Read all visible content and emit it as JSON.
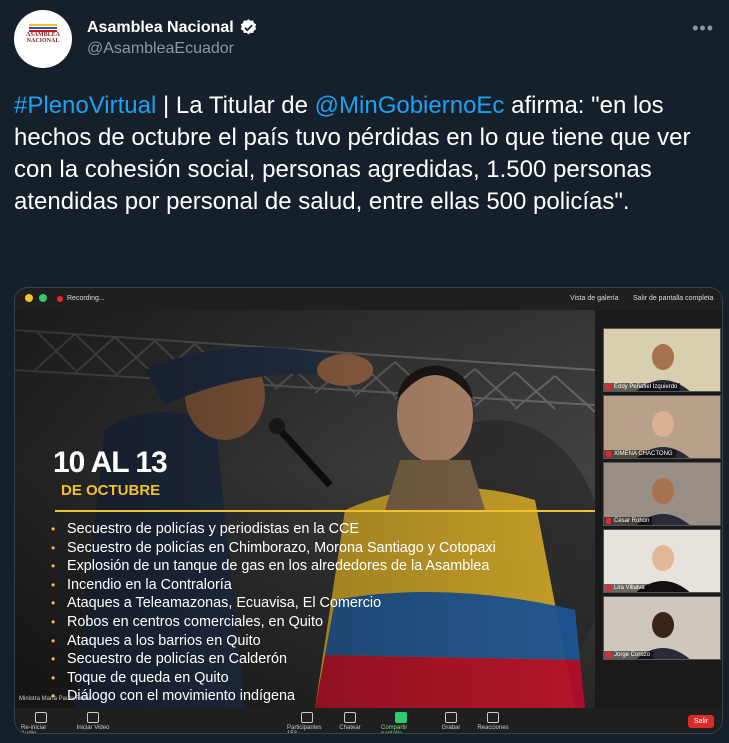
{
  "account": {
    "name": "Asamblea Nacional",
    "handle": "@AsambleaEcuador",
    "avatar_text": "ASAMBLEA NACIONAL",
    "more_label": "•••"
  },
  "tweet": {
    "hashtag": "#PlenoVirtual",
    "part1": " | La Titular de ",
    "mention": "@MinGobiernoEc",
    "part2": " afirma: \"en los hechos de octubre el país tuvo pérdidas en lo que tiene que ver con la cohesión social, personas agredidas, 1.500 personas atendidas por personal de salud, entre ellas 500 policías\"."
  },
  "zoom": {
    "recording_label": "Recording...",
    "gallery_label": "Vista de galería",
    "fullscreen_label": "Salir de pantalla completa",
    "date_big": "10 AL 13",
    "date_month": "DE OCTUBRE",
    "events": [
      "Secuestro de policías y periodistas en la CCE",
      "Secuestro de policías en Chimborazo, Morona Santiago y Cotopaxi",
      "Explosión de un tanque de gas en los alrededores de la Asamblea",
      "Incendio en la Contraloría",
      "Ataques a Teleamazonas, Ecuavisa, El Comercio",
      "Robos en centros comerciales, en Quito",
      "Ataques a los barrios en Quito",
      "Secuestro de policías en Calderón",
      "Toque de queda en Quito",
      "Diálogo con el movimiento indígena"
    ],
    "speaker_credit": "Ministra María Paula Romo",
    "participants": [
      {
        "name": "Eddy Peñafiel Izquierdo"
      },
      {
        "name": "XIMENA CHACTONG"
      },
      {
        "name": "César Rohon"
      },
      {
        "name": "Lira Villalva"
      },
      {
        "name": "Jorge Corozo"
      }
    ],
    "toolbar": {
      "audio": "Re-iniciar Audio",
      "video": "Iniciar Video",
      "participants": "Participantes",
      "participants_count": "153",
      "chat": "Chatear",
      "share": "Compartir pantalla",
      "record": "Grabar",
      "reactions": "Reacciones",
      "leave": "Salir"
    }
  },
  "colors": {
    "background": "#15202b",
    "link": "#1da1f2",
    "verified": "#ffffff",
    "accent_yellow": "#f2c12e",
    "leave_red": "#d92a2a"
  }
}
